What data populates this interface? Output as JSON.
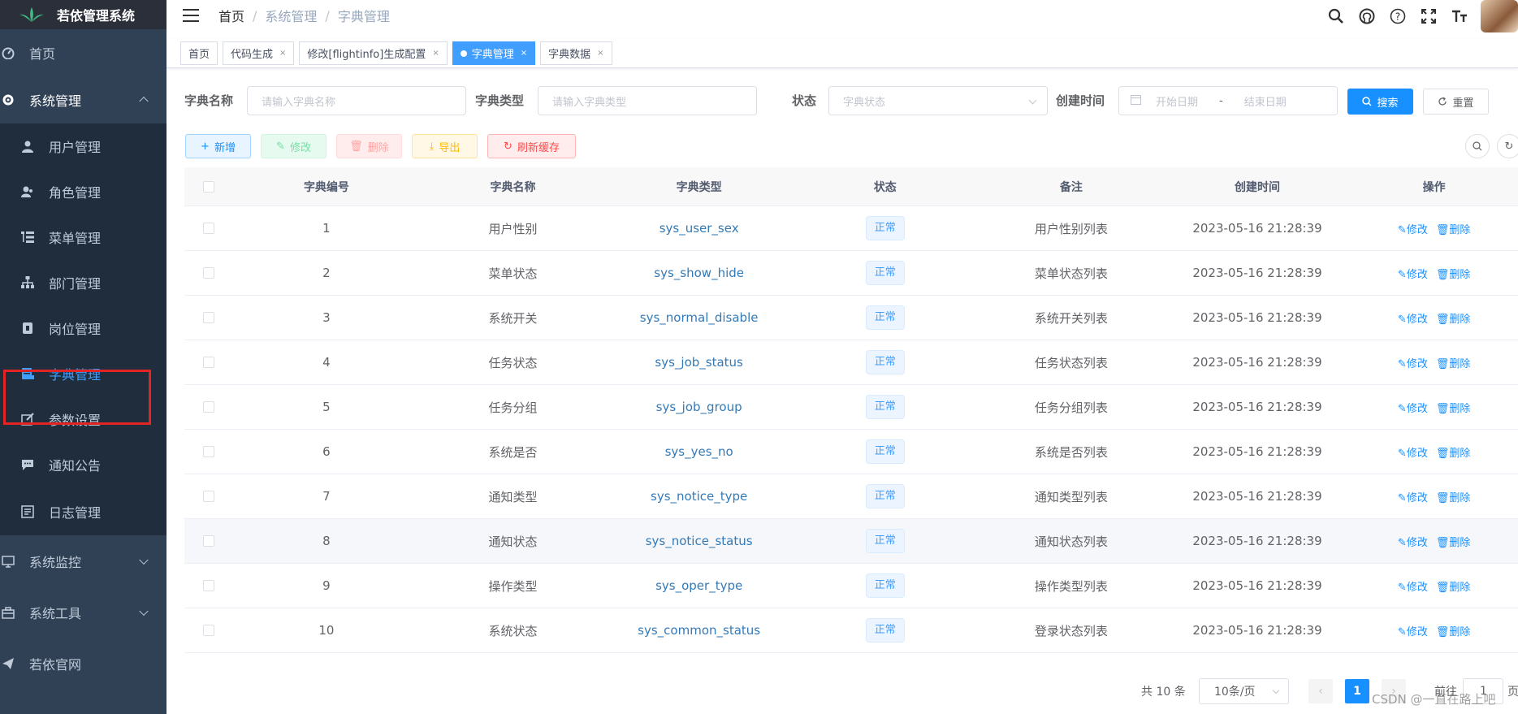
{
  "app": {
    "title": "若依管理系统"
  },
  "sidebar": {
    "items": [
      {
        "label": "首页",
        "icon": "dashboard-icon"
      },
      {
        "label": "系统管理",
        "icon": "gear-icon",
        "expanded": true
      },
      {
        "label": "系统监控",
        "icon": "monitor-icon"
      },
      {
        "label": "系统工具",
        "icon": "toolbox-icon"
      },
      {
        "label": "若依官网",
        "icon": "send-icon"
      }
    ],
    "sub_items": [
      {
        "label": "用户管理",
        "icon": "user-icon"
      },
      {
        "label": "角色管理",
        "icon": "users-icon"
      },
      {
        "label": "菜单管理",
        "icon": "tree-table-icon"
      },
      {
        "label": "部门管理",
        "icon": "org-tree-icon"
      },
      {
        "label": "岗位管理",
        "icon": "post-icon"
      },
      {
        "label": "字典管理",
        "icon": "dict-icon",
        "active": true
      },
      {
        "label": "参数设置",
        "icon": "edit-icon"
      },
      {
        "label": "通知公告",
        "icon": "message-icon"
      },
      {
        "label": "日志管理",
        "icon": "log-icon"
      }
    ]
  },
  "breadcrumb": [
    "首页",
    "系统管理",
    "字典管理"
  ],
  "tags": [
    {
      "label": "首页"
    },
    {
      "label": "代码生成"
    },
    {
      "label": "修改[flightinfo]生成配置"
    },
    {
      "label": "字典管理",
      "active": true
    },
    {
      "label": "字典数据"
    }
  ],
  "search": {
    "dict_name_label": "字典名称",
    "dict_name_placeholder": "请输入字典名称",
    "dict_type_label": "字典类型",
    "dict_type_placeholder": "请输入字典类型",
    "status_label": "状态",
    "status_placeholder": "字典状态",
    "create_time_label": "创建时间",
    "start_placeholder": "开始日期",
    "date_sep": "-",
    "end_placeholder": "结束日期",
    "search_btn": "搜索",
    "reset_btn": "重置"
  },
  "toolbar": {
    "add": "新增",
    "edit": "修改",
    "delete": "删除",
    "export": "导出",
    "refresh_cache": "刷新缓存"
  },
  "table": {
    "columns": [
      "字典编号",
      "字典名称",
      "字典类型",
      "状态",
      "备注",
      "创建时间",
      "操作"
    ],
    "rows": [
      {
        "id": "1",
        "name": "用户性别",
        "type": "sys_user_sex",
        "status": "正常",
        "remark": "用户性别列表",
        "time": "2023-05-16 21:28:39"
      },
      {
        "id": "2",
        "name": "菜单状态",
        "type": "sys_show_hide",
        "status": "正常",
        "remark": "菜单状态列表",
        "time": "2023-05-16 21:28:39"
      },
      {
        "id": "3",
        "name": "系统开关",
        "type": "sys_normal_disable",
        "status": "正常",
        "remark": "系统开关列表",
        "time": "2023-05-16 21:28:39"
      },
      {
        "id": "4",
        "name": "任务状态",
        "type": "sys_job_status",
        "status": "正常",
        "remark": "任务状态列表",
        "time": "2023-05-16 21:28:39"
      },
      {
        "id": "5",
        "name": "任务分组",
        "type": "sys_job_group",
        "status": "正常",
        "remark": "任务分组列表",
        "time": "2023-05-16 21:28:39"
      },
      {
        "id": "6",
        "name": "系统是否",
        "type": "sys_yes_no",
        "status": "正常",
        "remark": "系统是否列表",
        "time": "2023-05-16 21:28:39"
      },
      {
        "id": "7",
        "name": "通知类型",
        "type": "sys_notice_type",
        "status": "正常",
        "remark": "通知类型列表",
        "time": "2023-05-16 21:28:39"
      },
      {
        "id": "8",
        "name": "通知状态",
        "type": "sys_notice_status",
        "status": "正常",
        "remark": "通知状态列表",
        "time": "2023-05-16 21:28:39"
      },
      {
        "id": "9",
        "name": "操作类型",
        "type": "sys_oper_type",
        "status": "正常",
        "remark": "操作类型列表",
        "time": "2023-05-16 21:28:39"
      },
      {
        "id": "10",
        "name": "系统状态",
        "type": "sys_common_status",
        "status": "正常",
        "remark": "登录状态列表",
        "time": "2023-05-16 21:28:39"
      }
    ],
    "op_edit": "修改",
    "op_delete": "删除"
  },
  "pagination": {
    "total": "共 10 条",
    "page_size": "10条/页",
    "current_page": "1",
    "goto_prefix": "前往",
    "goto_value": "1",
    "goto_suffix": "页"
  },
  "watermark": "CSDN @一直在路上吧",
  "colors": {
    "sidebar_bg": "#304156",
    "primary": "#1890ff",
    "active_menu": "#409eff",
    "highlight": "#e32424"
  }
}
